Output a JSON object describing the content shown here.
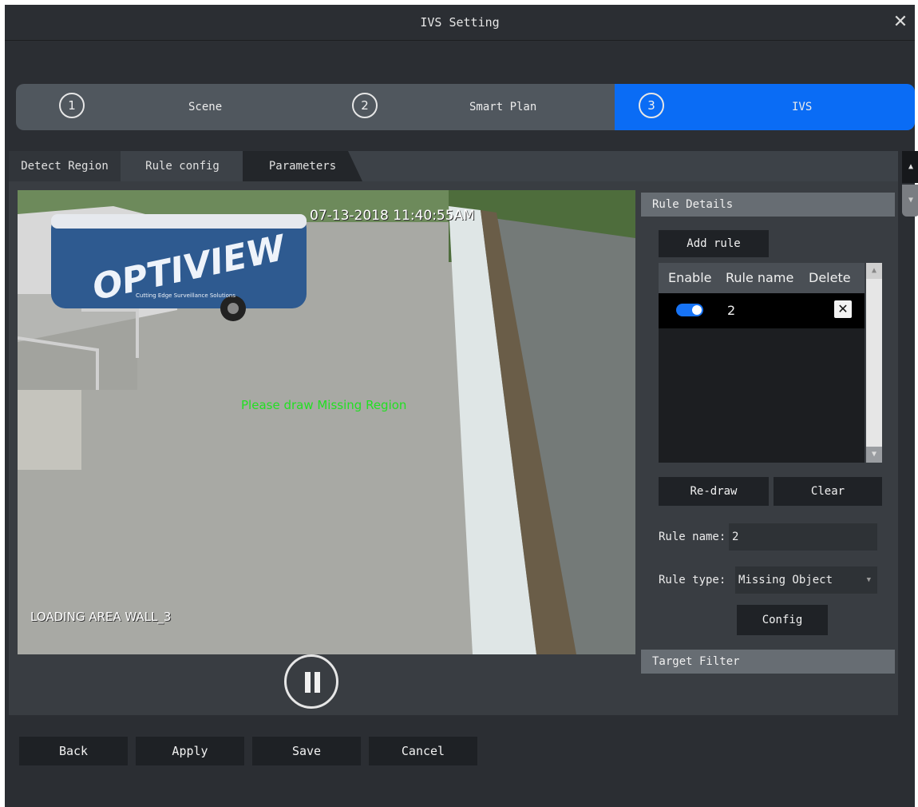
{
  "window": {
    "title": "IVS Setting"
  },
  "steps": [
    {
      "num": "1",
      "label": "Scene"
    },
    {
      "num": "2",
      "label": "Smart Plan"
    },
    {
      "num": "3",
      "label": "IVS"
    }
  ],
  "tabs": [
    "Detect Region",
    "Rule config",
    "Parameters"
  ],
  "video": {
    "timestamp": "07-13-2018 11:40:55AM",
    "prompt": "Please draw Missing Region",
    "camera_label": "LOADING AREA WALL_3",
    "bus_brand": "OPTIVIEW",
    "bus_tagline": "Cutting Edge Surveillance Solutions"
  },
  "rule_details": {
    "heading": "Rule Details",
    "add_rule": "Add rule",
    "columns": [
      "Enable",
      "Rule name",
      "Delete"
    ],
    "rows": [
      {
        "enabled": true,
        "name": "2"
      }
    ],
    "redraw": "Re-draw",
    "clear": "Clear",
    "rule_name_label": "Rule name:",
    "rule_name_value": "2",
    "rule_type_label": "Rule type:",
    "rule_type_value": "Missing Object",
    "config": "Config"
  },
  "target_filter": {
    "heading": "Target Filter"
  },
  "footer": {
    "back": "Back",
    "apply": "Apply",
    "save": "Save",
    "cancel": "Cancel"
  },
  "colors": {
    "accent": "#0a6cf5",
    "prompt_text": "#22e022",
    "background": "#2b2e33"
  }
}
